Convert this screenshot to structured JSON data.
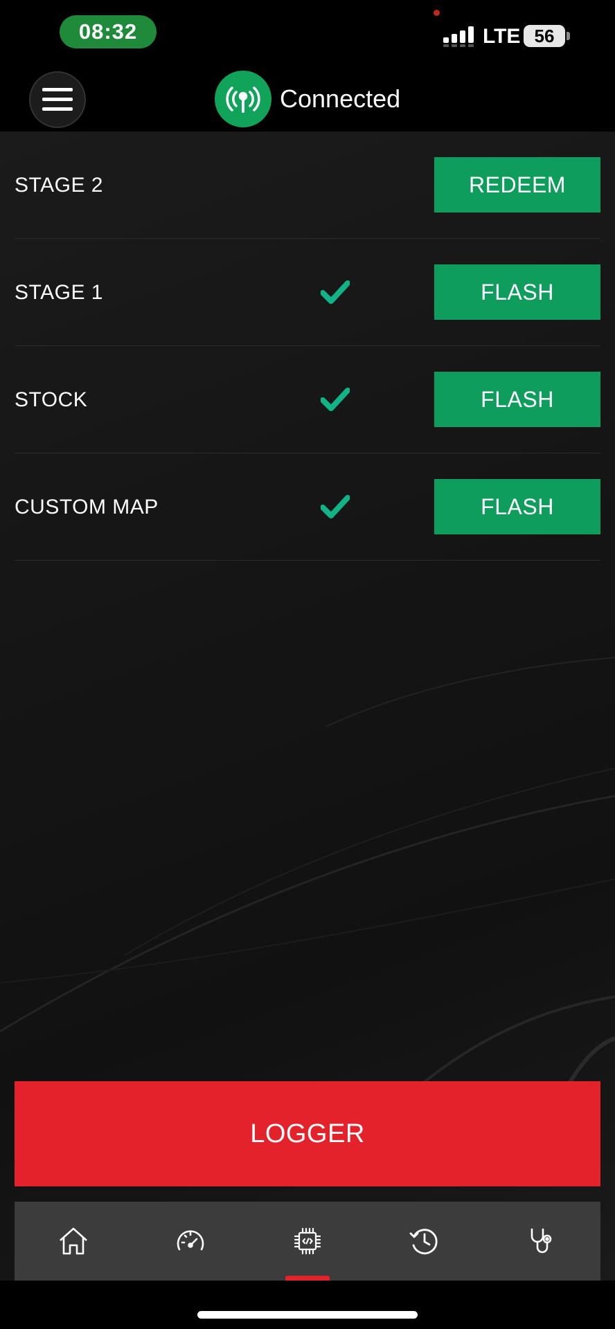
{
  "status_bar": {
    "time": "08:32",
    "network": "LTE",
    "battery": "56"
  },
  "header": {
    "connection_status": "Connected"
  },
  "maps": [
    {
      "label": "STAGE 2",
      "installed": false,
      "action": "REDEEM"
    },
    {
      "label": "STAGE 1",
      "installed": true,
      "action": "FLASH"
    },
    {
      "label": "STOCK",
      "installed": true,
      "action": "FLASH"
    },
    {
      "label": "CUSTOM MAP",
      "installed": true,
      "action": "FLASH"
    }
  ],
  "logger_button": "LOGGER",
  "tabs": [
    {
      "icon": "home-icon",
      "active": false
    },
    {
      "icon": "speedometer-icon",
      "active": false
    },
    {
      "icon": "chip-icon",
      "active": true
    },
    {
      "icon": "history-icon",
      "active": false
    },
    {
      "icon": "stethoscope-icon",
      "active": false
    }
  ],
  "colors": {
    "accent_green": "#0e9d5d",
    "accent_red": "#e4222b",
    "check_green": "#12b386"
  }
}
